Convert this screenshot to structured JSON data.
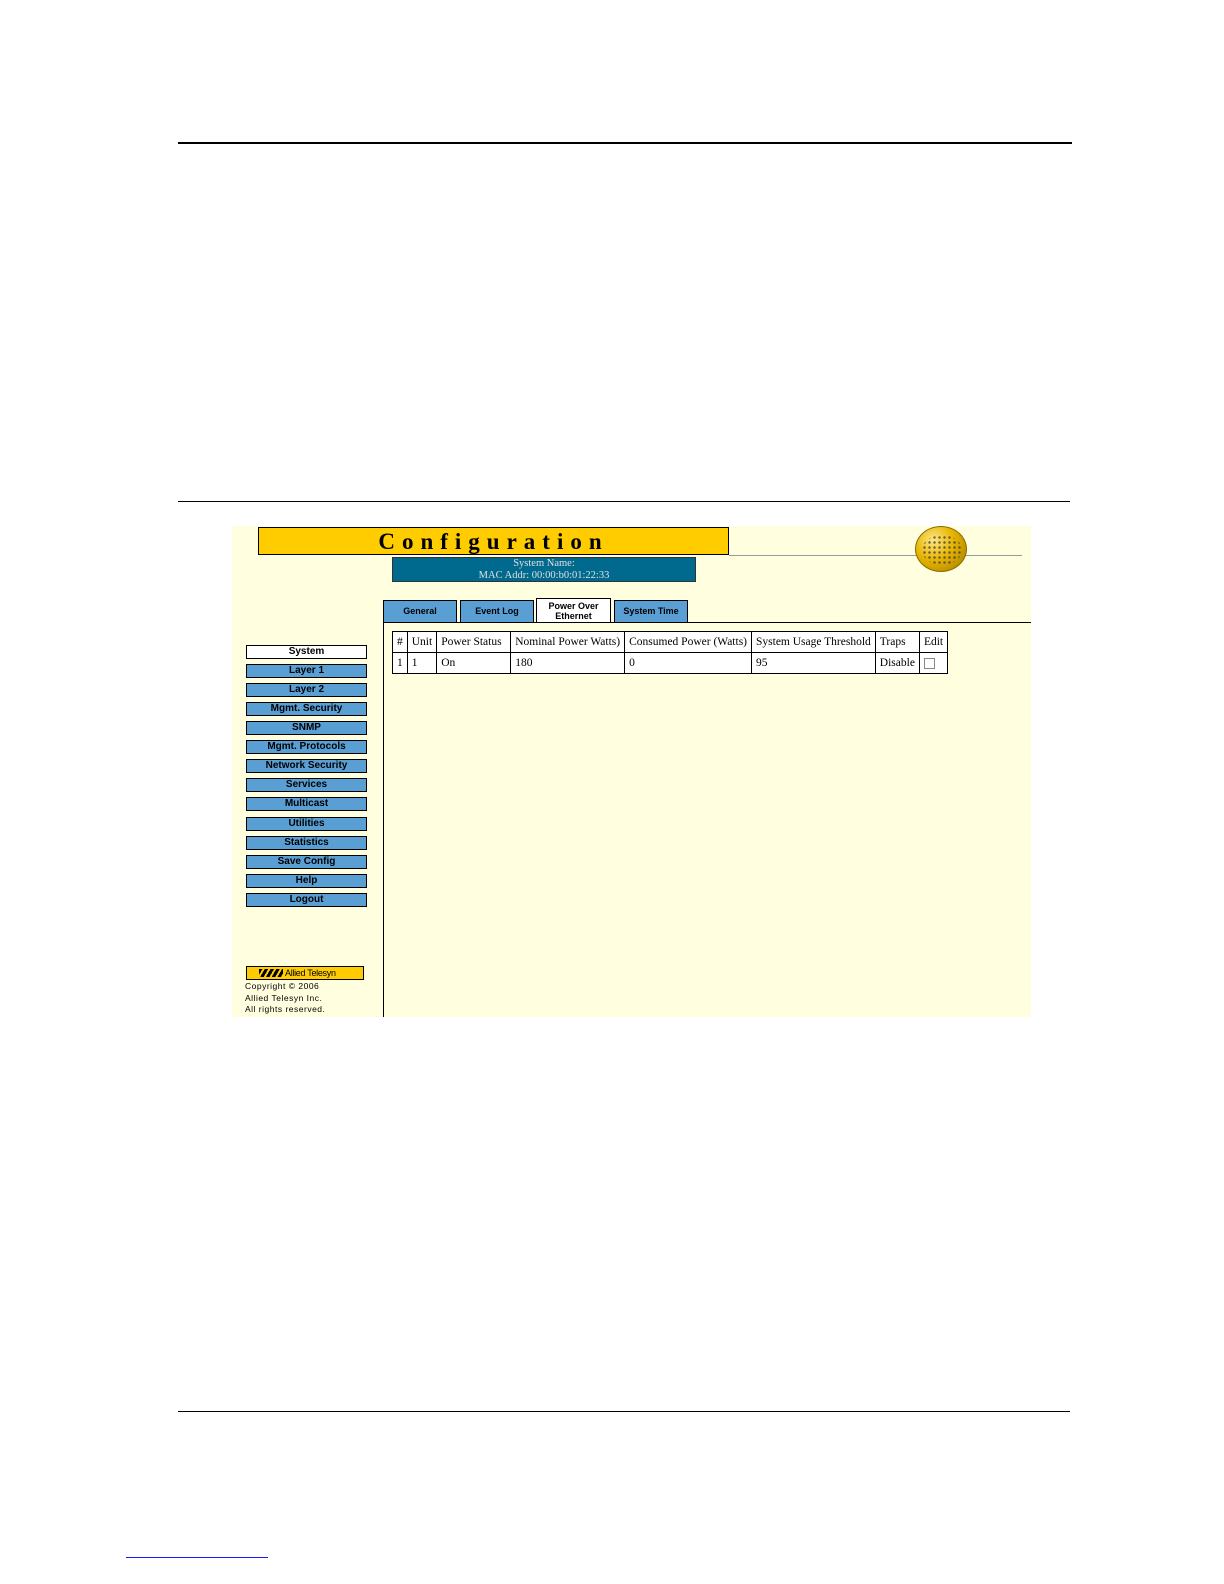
{
  "header": {
    "title": "Configuration"
  },
  "system_info": {
    "name_line": "System Name:",
    "mac_line": "MAC Addr:  00:00:b0:01:22:33"
  },
  "tabs": [
    {
      "label": "General"
    },
    {
      "label": "Event Log"
    },
    {
      "label_line1": "Power Over",
      "label_line2": "Ethernet",
      "active": true
    },
    {
      "label": "System Time"
    }
  ],
  "sidebar": {
    "items": [
      {
        "label": "System",
        "active": true
      },
      {
        "label": "Layer 1"
      },
      {
        "label": "Layer 2"
      },
      {
        "label": "Mgmt. Security"
      },
      {
        "label": "SNMP"
      },
      {
        "label": "Mgmt. Protocols"
      },
      {
        "label": "Network Security"
      },
      {
        "label": "Services"
      },
      {
        "label": "Multicast"
      },
      {
        "label": "Utilities"
      },
      {
        "label": "Statistics"
      },
      {
        "label": "Save Config"
      },
      {
        "label": "Help"
      },
      {
        "label": "Logout"
      }
    ]
  },
  "table": {
    "headers": [
      "#",
      "Unit",
      "Power Status",
      "Nominal Power Watts)",
      "Consumed Power (Watts)",
      "System Usage Threshold",
      "Traps",
      "Edit"
    ],
    "rows": [
      {
        "num": "1",
        "unit": "1",
        "status": "On",
        "nominal": "180",
        "consumed": "0",
        "threshold": "95",
        "traps": "Disable",
        "edit_checked": false
      }
    ]
  },
  "footer": {
    "logo_text": "Allied Telesyn",
    "copyright_line1": "Copyright © 2006",
    "copyright_line2": "Allied Telesyn Inc.",
    "copyright_line3": "All rights reserved."
  },
  "colors": {
    "accent_yellow": "#ffcc00",
    "panel_bg": "#ffffe0",
    "button_blue": "#5a9fd4",
    "info_teal": "#006a8e"
  }
}
